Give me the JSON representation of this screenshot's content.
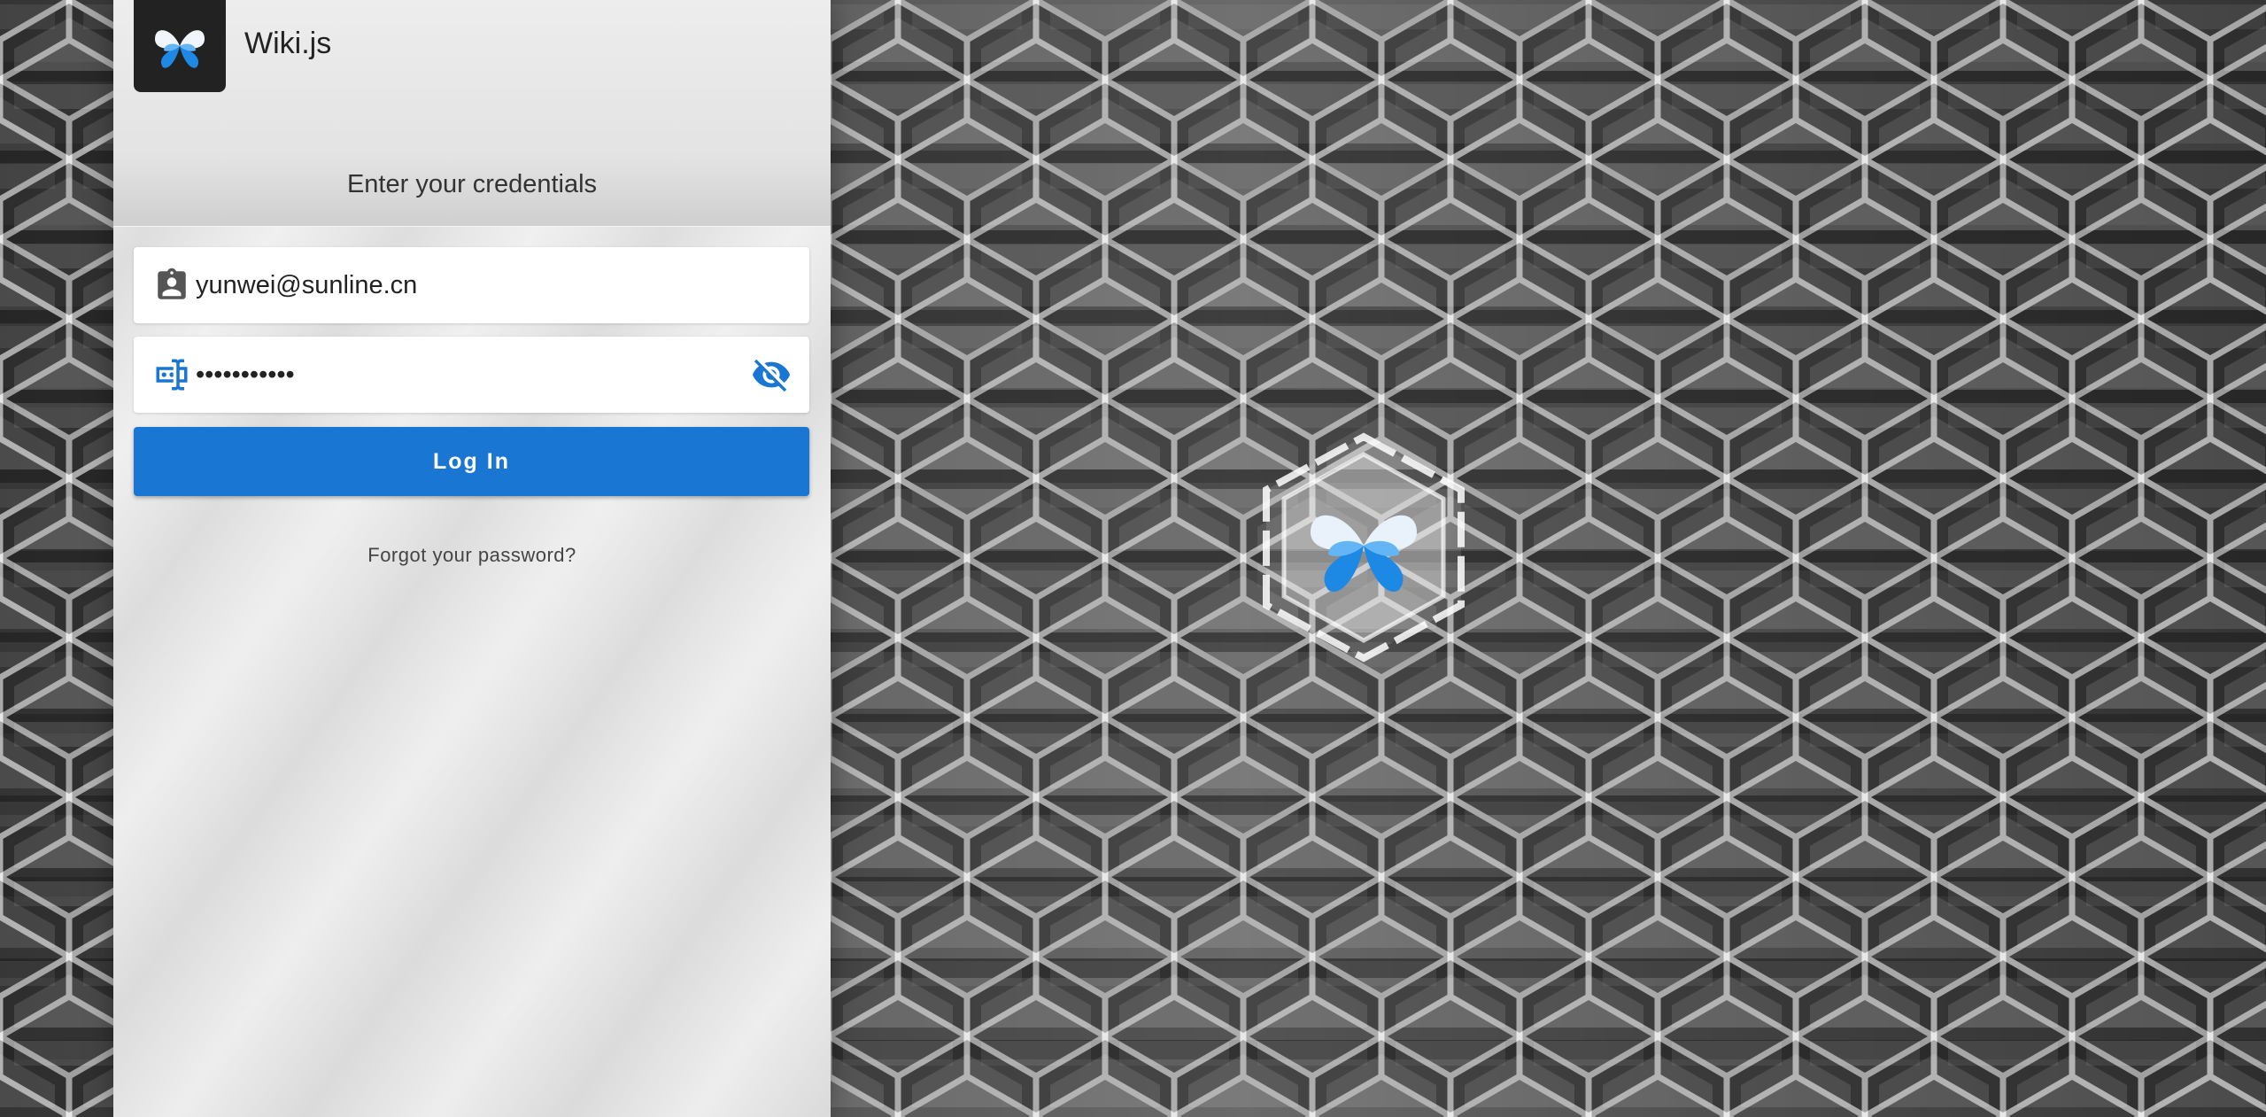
{
  "brand": {
    "title": "Wiki.js",
    "logo_icon": "butterfly-logo-icon"
  },
  "login": {
    "subtitle": "Enter your credentials",
    "email": {
      "value": "yunwei@sunline.cn",
      "icon": "account-box-icon"
    },
    "password": {
      "value": "•••••••••••",
      "icon": "password-field-icon",
      "toggle_icon": "eye-off-icon"
    },
    "login_button": "Log In",
    "forgot_link": "Forgot your password?"
  },
  "colors": {
    "primary": "#1976d2",
    "panel": "#e6e6e6",
    "logo_bg": "#222222"
  }
}
